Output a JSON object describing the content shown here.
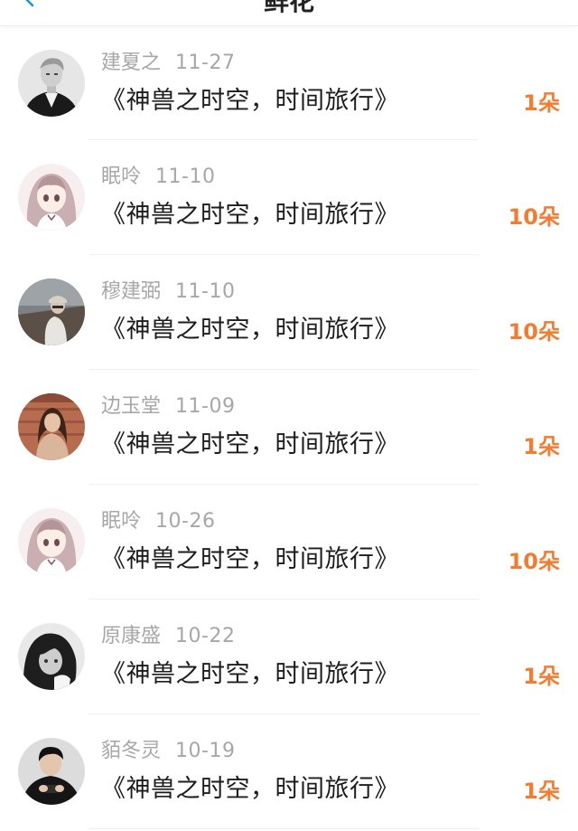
{
  "header": {
    "title": "鲜花",
    "back_icon": "chevron-left-icon"
  },
  "colors": {
    "accent": "#f47c30",
    "name": "#a7a7a7",
    "work": "#1c1c1c",
    "back": "#1f8ef1"
  },
  "items": [
    {
      "name": "建夏之",
      "date": "11-27",
      "work": "《神兽之时空，时间旅行》",
      "amount": "1朵",
      "avatar": "avatar-man-dark-jacket"
    },
    {
      "name": "眠呤",
      "date": "11-10",
      "work": "《神兽之时空，时间旅行》",
      "amount": "10朵",
      "avatar": "avatar-anime-girl"
    },
    {
      "name": "穆建弼",
      "date": "11-10",
      "work": "《神兽之时空，时间旅行》",
      "amount": "10朵",
      "avatar": "avatar-person-outdoor"
    },
    {
      "name": "边玉堂",
      "date": "11-09",
      "work": "《神兽之时空，时间旅行》",
      "amount": "1朵",
      "avatar": "avatar-girl-brown-hair"
    },
    {
      "name": "眠呤",
      "date": "10-26",
      "work": "《神兽之时空，时间旅行》",
      "amount": "10朵",
      "avatar": "avatar-anime-girl"
    },
    {
      "name": "原康盛",
      "date": "10-22",
      "work": "《神兽之时空，时间旅行》",
      "amount": "1朵",
      "avatar": "avatar-girl-monochrome"
    },
    {
      "name": "貊冬灵",
      "date": "10-19",
      "work": "《神兽之时空，时间旅行》",
      "amount": "1朵",
      "avatar": "avatar-boy-phone"
    }
  ]
}
